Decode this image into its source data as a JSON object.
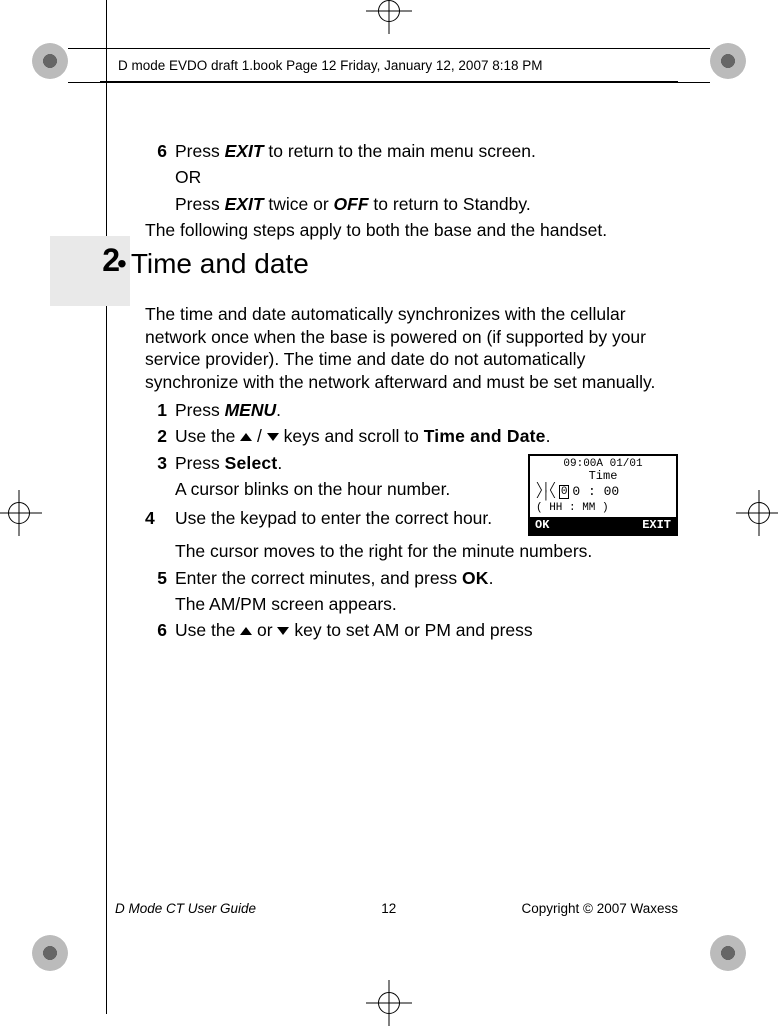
{
  "header_line": "D mode EVDO draft 1.book  Page 12  Friday, January 12, 2007  8:18 PM",
  "chapter_number": "2",
  "pre_steps": {
    "n6": "6",
    "s6a": "Press ",
    "s6_exit": "EXIT",
    "s6b": " to return to the main menu screen.",
    "s6_or": "OR",
    "s6c": "Press ",
    "s6_exit2": "EXIT",
    "s6d": " twice or ",
    "s6_off": "OFF",
    "s6e": " to return to Standby."
  },
  "intro": "The following steps apply to both the base and the handset.",
  "section_title": "Time and date",
  "body_para": "The time and date automatically synchronizes with the cellular network once when the base is powered on (if supported by your service provider).  The time and date do not automatically synchronize with the network afterward and must be set manually.",
  "steps": {
    "n1": "1",
    "s1a": "Press ",
    "s1_menu": "MENU",
    "s1b": ".",
    "n2": "2",
    "s2a": "Use the ",
    "s2b": " keys and scroll to ",
    "s2_td": "Time and Date",
    "s2c": ".",
    "n3": "3",
    "s3a": "Press ",
    "s3_select": "Select",
    "s3b": ".",
    "s3_sub": "A cursor blinks on the hour number.",
    "n4": "4",
    "s4a": "Use the keypad to enter the correct hour.",
    "s4_sub": "The cursor moves to the right for the minute numbers.",
    "n5": "5",
    "s5a": "Enter the correct minutes, and press ",
    "s5_ok": "OK",
    "s5b": ".",
    "s5_sub": "The AM/PM screen appears.",
    "n6": "6",
    "s6a": "Use the ",
    "s6b": " or ",
    "s6c": " key to set AM or PM and press"
  },
  "phone": {
    "status": "09:00A 01/01",
    "title": "Time",
    "cursor": "0",
    "rest": "0 : 00",
    "hint": "( HH : MM )",
    "sk_left": "OK",
    "sk_right": "EXIT"
  },
  "footer": {
    "left": "D Mode CT User Guide",
    "page": "12",
    "right": "Copyright © 2007 Waxess"
  }
}
